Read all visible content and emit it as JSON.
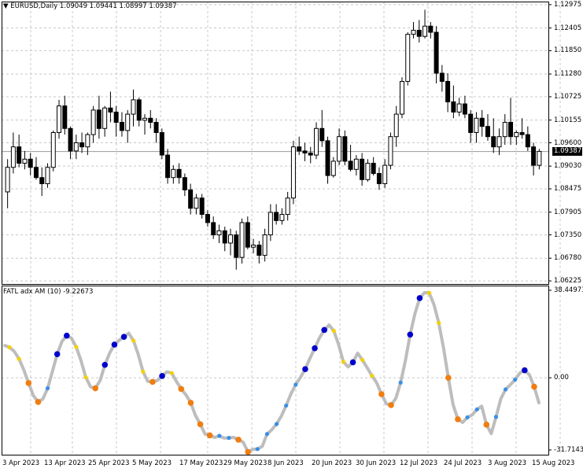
{
  "main_pane": {
    "title_symbol": "▼",
    "title": "EURUSD,Daily",
    "ohlc": "1.09049 1.09441 1.08997 1.09387",
    "current_price": "1.09387",
    "price_ticks": [
      "1.12975",
      "1.12405",
      "1.11850",
      "1.11280",
      "1.10725",
      "1.10155",
      "1.09600",
      "1.09030",
      "1.08475",
      "1.07905",
      "1.07350",
      "1.06780",
      "1.06225"
    ]
  },
  "indicator_pane": {
    "title": "FATL adx AM (10) -9.22673",
    "ticks": [
      "38.44973",
      "0.00",
      "-31.71433"
    ]
  },
  "time_axis": {
    "labels": [
      "3 Apr 2023",
      "13 Apr 2023",
      "25 Apr 2023",
      "5 May 2023",
      "17 May 2023",
      "29 May 2023",
      "8 Jun 2023",
      "20 Jun 2023",
      "30 Jun 2023",
      "12 Jul 2023",
      "24 Jul 2023",
      "3 Aug 2023",
      "15 Aug 2023"
    ]
  },
  "colors": {
    "bull_body": "#ffffff",
    "bear_body": "#000000",
    "grid": "#c8c8c8",
    "line": "#bdbdbd",
    "dot_dark_blue": "#0000cc",
    "dot_light_blue": "#3a8fe6",
    "dot_yellow": "#f5d000",
    "dot_orange": "#f07d10"
  },
  "chart_data": [
    {
      "type": "candlestick",
      "title": "EURUSD,Daily",
      "ylim": [
        1.0615,
        1.1305
      ],
      "series": [
        {
          "name": "EURUSD",
          "ohlc": [
            [
              1.084,
              1.092,
              1.08,
              1.09
            ],
            [
              1.09,
              1.0985,
              1.0885,
              1.095
            ],
            [
              1.095,
              1.098,
              1.09,
              1.091
            ],
            [
              1.091,
              1.094,
              1.0895,
              1.092
            ],
            [
              1.092,
              1.0935,
              1.088,
              1.09
            ],
            [
              1.09,
              1.0925,
              1.087,
              1.0875
            ],
            [
              1.0875,
              1.09,
              1.083,
              1.086
            ],
            [
              1.086,
              1.091,
              1.085,
              1.09
            ],
            [
              1.09,
              1.099,
              1.089,
              1.0985
            ],
            [
              1.0985,
              1.1065,
              1.097,
              1.105
            ],
            [
              1.105,
              1.1075,
              1.098,
              1.0995
            ],
            [
              1.0995,
              1.1,
              1.092,
              1.094
            ],
            [
              1.094,
              1.098,
              1.092,
              1.096
            ],
            [
              1.096,
              1.0985,
              1.0935,
              1.095
            ],
            [
              1.095,
              1.0985,
              1.093,
              1.098
            ],
            [
              1.098,
              1.105,
              1.096,
              1.104
            ],
            [
              1.104,
              1.1075,
              1.097,
              1.0995
            ],
            [
              1.0995,
              1.105,
              1.0975,
              1.1045
            ],
            [
              1.1045,
              1.1085,
              1.101,
              1.1035
            ],
            [
              1.1035,
              1.105,
              1.0975,
              1.101
            ],
            [
              1.101,
              1.1035,
              1.0975,
              1.099
            ],
            [
              1.099,
              1.104,
              1.096,
              1.103
            ],
            [
              1.103,
              1.109,
              1.1,
              1.1065
            ],
            [
              1.1065,
              1.107,
              1.1,
              1.1015
            ],
            [
              1.1015,
              1.103,
              1.098,
              1.102
            ],
            [
              1.102,
              1.104,
              1.0995,
              1.101
            ],
            [
              1.101,
              1.102,
              1.096,
              1.0985
            ],
            [
              1.0985,
              1.0995,
              1.092,
              1.093
            ],
            [
              1.093,
              1.0945,
              1.086,
              1.0875
            ],
            [
              1.0875,
              1.0905,
              1.086,
              1.0895
            ],
            [
              1.0895,
              1.091,
              1.086,
              1.0875
            ],
            [
              1.0875,
              1.0885,
              1.083,
              1.0845
            ],
            [
              1.0845,
              1.086,
              1.0785,
              1.08
            ],
            [
              1.08,
              1.0835,
              1.0785,
              1.0825
            ],
            [
              1.0825,
              1.0835,
              1.0775,
              1.0785
            ],
            [
              1.0785,
              1.0795,
              1.0755,
              1.0765
            ],
            [
              1.0765,
              1.078,
              1.0725,
              1.0735
            ],
            [
              1.0735,
              1.076,
              1.0715,
              1.0745
            ],
            [
              1.0745,
              1.0755,
              1.0695,
              1.0715
            ],
            [
              1.0715,
              1.075,
              1.0685,
              1.0735
            ],
            [
              1.0735,
              1.0745,
              1.065,
              1.068
            ],
            [
              1.068,
              1.0775,
              1.0665,
              1.0765
            ],
            [
              1.0765,
              1.078,
              1.07,
              1.0705
            ],
            [
              1.0705,
              1.0725,
              1.069,
              1.071
            ],
            [
              1.071,
              1.072,
              1.0665,
              1.0685
            ],
            [
              1.0685,
              1.075,
              1.067,
              1.0735
            ],
            [
              1.0735,
              1.081,
              1.072,
              1.079
            ],
            [
              1.079,
              1.081,
              1.076,
              1.077
            ],
            [
              1.077,
              1.08,
              1.076,
              1.0785
            ],
            [
              1.0785,
              1.084,
              1.077,
              1.0825
            ],
            [
              1.0825,
              1.0965,
              1.081,
              1.095
            ],
            [
              1.095,
              1.0975,
              1.093,
              1.094
            ],
            [
              1.094,
              1.096,
              1.0915,
              1.0935
            ],
            [
              1.0935,
              1.095,
              1.091,
              1.093
            ],
            [
              1.093,
              1.101,
              1.092,
              1.0995
            ],
            [
              1.0995,
              1.104,
              1.095,
              1.0965
            ],
            [
              1.0965,
              1.0975,
              1.086,
              1.088
            ],
            [
              1.088,
              1.0925,
              1.0875,
              1.0915
            ],
            [
              1.0915,
              1.0995,
              1.0905,
              1.0975
            ],
            [
              1.0975,
              1.099,
              1.0905,
              1.0915
            ],
            [
              1.0915,
              1.0955,
              1.089,
              1.0895
            ],
            [
              1.0895,
              1.093,
              1.088,
              1.092
            ],
            [
              1.092,
              1.0935,
              1.0855,
              1.087
            ],
            [
              1.087,
              1.092,
              1.0865,
              1.091
            ],
            [
              1.091,
              1.0925,
              1.088,
              1.0885
            ],
            [
              1.0885,
              1.09,
              1.0845,
              1.086
            ],
            [
              1.086,
              1.092,
              1.085,
              1.0905
            ],
            [
              1.0905,
              1.0985,
              1.0895,
              1.0975
            ],
            [
              1.0975,
              1.105,
              1.095,
              1.103
            ],
            [
              1.103,
              1.112,
              1.102,
              1.111
            ],
            [
              1.111,
              1.123,
              1.11,
              1.1225
            ],
            [
              1.1225,
              1.1255,
              1.1215,
              1.1235
            ],
            [
              1.1235,
              1.126,
              1.1205,
              1.122
            ],
            [
              1.122,
              1.1285,
              1.1215,
              1.1245
            ],
            [
              1.1245,
              1.1255,
              1.1215,
              1.123
            ],
            [
              1.123,
              1.1245,
              1.1105,
              1.113
            ],
            [
              1.113,
              1.115,
              1.1085,
              1.111
            ],
            [
              1.111,
              1.113,
              1.1035,
              1.106
            ],
            [
              1.106,
              1.11,
              1.102,
              1.1035
            ],
            [
              1.1035,
              1.107,
              1.1025,
              1.1055
            ],
            [
              1.1055,
              1.1075,
              1.102,
              1.103
            ],
            [
              1.103,
              1.104,
              1.096,
              1.0985
            ],
            [
              1.0985,
              1.1035,
              1.096,
              1.102
            ],
            [
              1.102,
              1.104,
              1.0975,
              1.1
            ],
            [
              1.1,
              1.103,
              1.0965,
              1.0975
            ],
            [
              1.0975,
              1.102,
              1.0935,
              1.095
            ],
            [
              1.095,
              1.0995,
              1.093,
              1.0975
            ],
            [
              1.0975,
              1.103,
              1.0955,
              1.101
            ],
            [
              1.101,
              1.107,
              1.0955,
              1.0975
            ],
            [
              1.0975,
              1.099,
              1.0955,
              1.0985
            ],
            [
              1.0985,
              1.102,
              1.097,
              1.098
            ],
            [
              1.098,
              1.1,
              1.094,
              1.095
            ],
            [
              1.095,
              1.096,
              1.088,
              1.0905
            ],
            [
              1.0905,
              1.0945,
              1.0895,
              1.0939
            ]
          ]
        }
      ]
    },
    {
      "type": "line",
      "title": "FATL adx AM (10) -9.22673",
      "ylim": [
        -31.71433,
        38.44973
      ],
      "series": [
        {
          "name": "FATL adx AM (10)",
          "values": [
            14.2,
            13.4,
            11.6,
            8.3,
            3.5,
            -2.3,
            -7.8,
            -10.6,
            -9.3,
            -4.6,
            2.8,
            10.4,
            16.0,
            18.5,
            17.4,
            13.5,
            7.5,
            0.2,
            -4.0,
            -4.6,
            -1.2,
            5.7,
            10.9,
            14.6,
            16.5,
            18.0,
            19.6,
            16.3,
            10.2,
            2.7,
            -1.6,
            -1.8,
            -1.2,
            0.8,
            2.6,
            2.1,
            -1.6,
            -4.9,
            -7.5,
            -11.0,
            -16.6,
            -20.4,
            -24.7,
            -25.3,
            -26.2,
            -25.5,
            -26.5,
            -26.4,
            -26.2,
            -27.2,
            -28.3,
            -32.6,
            -31.4,
            -31.3,
            -30.1,
            -24.7,
            -22.8,
            -20.3,
            -16.8,
            -12.2,
            -7.1,
            -3.0,
            0.2,
            3.8,
            8.6,
            13.0,
            17.6,
            21.0,
            23.2,
            20.6,
            14.6,
            7.0,
            4.8,
            6.8,
            10.8,
            7.8,
            4.4,
            0.9,
            -2.3,
            -7.2,
            -11.4,
            -12.0,
            -9.0,
            -2.1,
            7.5,
            19.0,
            28.2,
            35.0,
            37.4,
            37.3,
            32.1,
            24.1,
            13.1,
            0.0,
            -11.8,
            -18.2,
            -19.6,
            -17.4,
            -16.3,
            -13.9,
            -12.5,
            -20.6,
            -24.5,
            -17.2,
            -9.3,
            -5.1,
            -3.1,
            -0.8,
            2.1,
            3.3,
            1.3,
            -3.9,
            -11.0
          ]
        }
      ]
    }
  ]
}
